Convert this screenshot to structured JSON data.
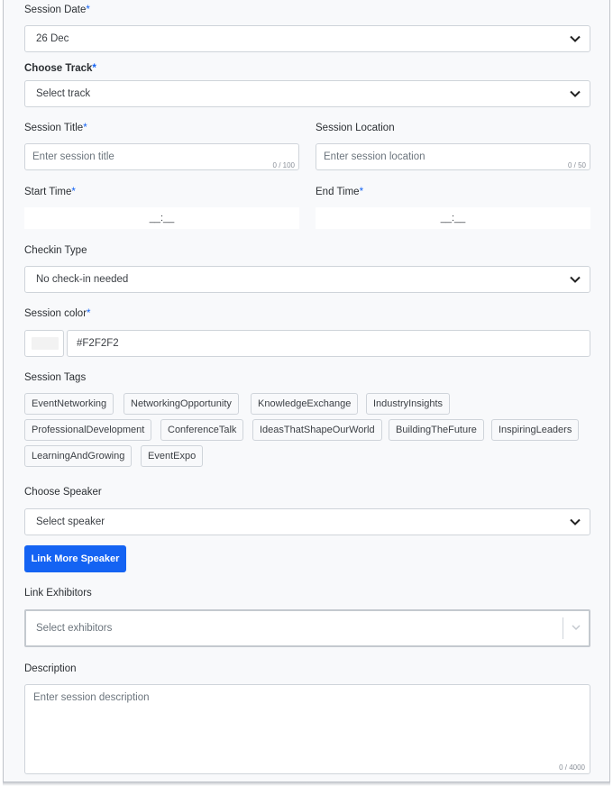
{
  "session_date": {
    "label": "Session Date",
    "required_mark": "*",
    "value": "26 Dec"
  },
  "track": {
    "label": "Choose Track",
    "required_mark": "*",
    "value": "Select track"
  },
  "session_title": {
    "label": "Session Title",
    "required_mark": "*",
    "placeholder": "Enter session title",
    "counter": "0 / 100"
  },
  "session_location": {
    "label": "Session Location",
    "placeholder": "Enter session location",
    "counter": "0 / 50"
  },
  "start_time": {
    "label": "Start Time",
    "required_mark": "*",
    "value": "__:__"
  },
  "end_time": {
    "label": "End Time",
    "required_mark": "*",
    "value": "__:__"
  },
  "checkin": {
    "label": "Checkin Type",
    "value": "No check-in needed"
  },
  "session_color": {
    "label": "Session color",
    "required_mark": "*",
    "value": "#F2F2F2",
    "swatch": "#F2F2F2"
  },
  "tags": {
    "label": "Session Tags",
    "items": [
      "EventNetworking",
      "NetworkingOpportunity",
      "KnowledgeExchange",
      "IndustryInsights",
      "ProfessionalDevelopment",
      "ConferenceTalk",
      "IdeasThatShapeOurWorld",
      "BuildingTheFuture",
      "InspiringLeaders",
      "LearningAndGrowing",
      "EventExpo"
    ]
  },
  "speaker": {
    "label": "Choose Speaker",
    "value": "Select speaker",
    "link_more_label": "Link More Speaker"
  },
  "exhibitors": {
    "label": "Link Exhibitors",
    "placeholder": "Select exhibitors"
  },
  "description": {
    "label": "Description",
    "placeholder": "Enter session description",
    "counter": "0 / 4000"
  },
  "colors": {
    "accent": "#1463F3",
    "border": "#CFD4DA",
    "background": "#F8F9FB"
  }
}
